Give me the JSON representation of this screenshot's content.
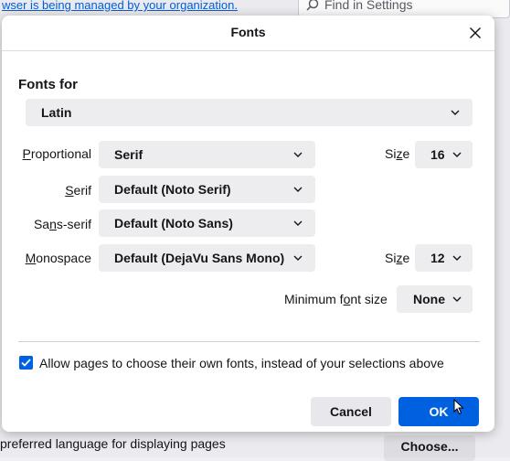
{
  "background": {
    "managed_notice": "wser is being managed by your organization.",
    "search_placeholder": "Find in Settings",
    "language_text": "preferred language for displaying pages",
    "choose_button": "Choose..."
  },
  "dialog": {
    "title": "Fonts",
    "fonts_for_label": "Fonts for",
    "language_select": "Latin",
    "rows": {
      "proportional": {
        "label_pre": "",
        "label_key": "P",
        "label_post": "roportional",
        "value": "Serif",
        "size_label_pre": "Si",
        "size_label_key": "z",
        "size_label_post": "e",
        "size_value": "16"
      },
      "serif": {
        "label_pre": "",
        "label_key": "S",
        "label_post": "erif",
        "value": "Default (Noto Serif)"
      },
      "sans_serif": {
        "label_pre": "Sa",
        "label_key": "n",
        "label_post": "s-serif",
        "value": "Default (Noto Sans)"
      },
      "monospace": {
        "label_pre": "",
        "label_key": "M",
        "label_post": "onospace",
        "value": "Default (DejaVu Sans Mono)",
        "size_label_pre": "Si",
        "size_label_key": "z",
        "size_label_post": "e",
        "size_value": "12"
      }
    },
    "minimum_font_size": {
      "label_pre": "Minimum f",
      "label_key": "o",
      "label_post": "nt size",
      "value": "None"
    },
    "allow_pages_checkbox": {
      "checked": true,
      "label": "Allow pages to choose their own fonts, instead of your selections above"
    },
    "buttons": {
      "cancel": "Cancel",
      "ok": "OK"
    }
  },
  "colors": {
    "accent": "#0061e0",
    "select_bg": "#ededf0",
    "page_bg": "#f0f0f4"
  }
}
